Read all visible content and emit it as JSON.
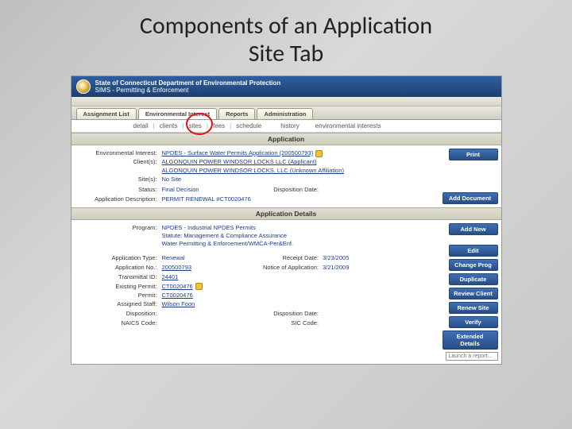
{
  "slide": {
    "title": "Components of an Application\nSite Tab"
  },
  "header": {
    "line1": "State of Connecticut Department of Environmental Protection",
    "line2": "SIMS - Permitting & Enforcement"
  },
  "tabs": [
    "Assignment List",
    "Environmental Interest",
    "Reports",
    "Administration"
  ],
  "subtabs": [
    "detail",
    "clients",
    "sites",
    "fees",
    "schedule",
    "history",
    "environmental interests"
  ],
  "sect1": "Application",
  "app": {
    "envint_lbl": "Environmental Interest:",
    "envint": "NPDES - Surface Water Permits Application (200500793)",
    "clients_lbl": "Client(s):",
    "client1": "ALGONQUIN POWER WINDSOR LOCKS LLC (Applicant)",
    "client2": "ALGONQUIN POWER WINDSOR LOCKS, LLC (Unknown Affiliation)",
    "sites_lbl": "Site(s):",
    "sites": "No Site",
    "status_lbl": "Status:",
    "status": "Final Decision",
    "dispdate_lbl": "Disposition Date:",
    "desc_lbl": "Application Description:",
    "desc": "PERMIT RENEWAL #CT0020476"
  },
  "btns1": {
    "print": "Print",
    "adddoc": "Add Document"
  },
  "sect2": "Application Details",
  "det": {
    "addnew": "Add New",
    "program_lbl": "Program:",
    "program1": "NPDES - Industrial NPDES Permits",
    "program2": "Statute: Management & Compliance Assurance",
    "program3": "Water Permitting & Enforcement/WMCA-Per&Enf.",
    "apptype_lbl": "Application Type:",
    "apptype": "Renewal",
    "recdate_lbl": "Receipt Date:",
    "recdate": "3/23/2005",
    "appno_lbl": "Application No.:",
    "appno": "200500793",
    "noa_lbl": "Notice of Application:",
    "noa": "3/21/2009",
    "trans_lbl": "Transmittal ID:",
    "trans": "24401",
    "expermit_lbl": "Existing Permit:",
    "expermit": "CT0020476",
    "permit_lbl": "Permit:",
    "permit": "CT0020476",
    "staff_lbl": "Assigned Staff:",
    "staff": "Wilson Foon",
    "disp_lbl": "Disposition:",
    "dispdate_lbl": "Disposition Date:",
    "naics_lbl": "NAICS Code:",
    "sic_lbl": "SIC Code:"
  },
  "btns2": {
    "edit": "Edit",
    "chgprog": "Change Prog",
    "dup": "Duplicate",
    "revcli": "Review Client",
    "rensite": "Renew Site",
    "verify": "Verify",
    "ext": "Extended Details"
  },
  "search": {
    "placeholder": "Launch a report..."
  }
}
